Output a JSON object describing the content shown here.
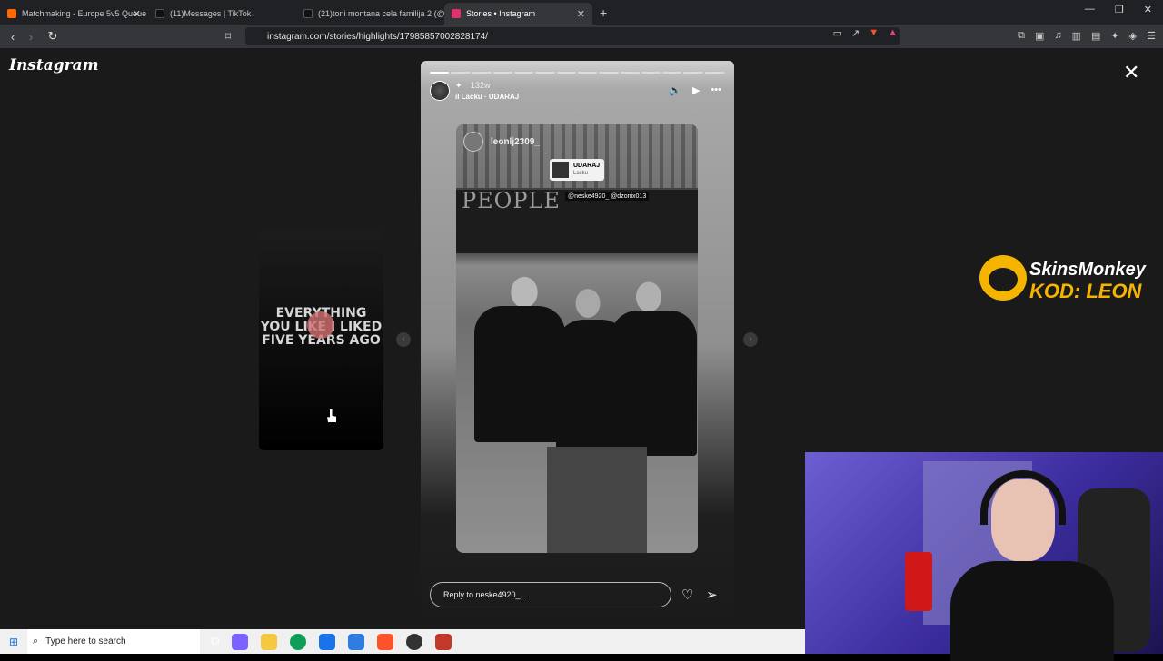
{
  "browser": {
    "tabs": [
      {
        "title": "Matchmaking - Europe 5v5 Queue - ",
        "color": "#ff6a00",
        "active": false
      },
      {
        "title": "(11)Messages | TikTok",
        "color": "#111111",
        "active": false
      },
      {
        "title": "(21)toni montana cela familija 2 (@to",
        "color": "#111111",
        "active": false
      },
      {
        "title": "Stories • Instagram",
        "color": "#e1306c",
        "active": true
      }
    ],
    "url": "instagram.com/stories/highlights/17985857002828174/"
  },
  "page": {
    "logo": "Instagram",
    "side_story_text": "EVERYTHING YOU LIKE I LIKED FIVE YEARS AGO",
    "story": {
      "time": "132w",
      "music": "Lacku · UDARAJ",
      "photo_user": "leonlj2309_",
      "sticker_title": "UDARAJ",
      "sticker_artist": "Lacku",
      "mentions": "@neske4920_ @dzonix013",
      "board_text": "PEOPLE"
    },
    "reply_placeholder": "Reply to neske4920_..."
  },
  "overlay": {
    "brand_line1": "SkinsMonkey",
    "brand_line2": "KOD: LEON"
  },
  "taskbar": {
    "search_placeholder": "Type here to search"
  }
}
